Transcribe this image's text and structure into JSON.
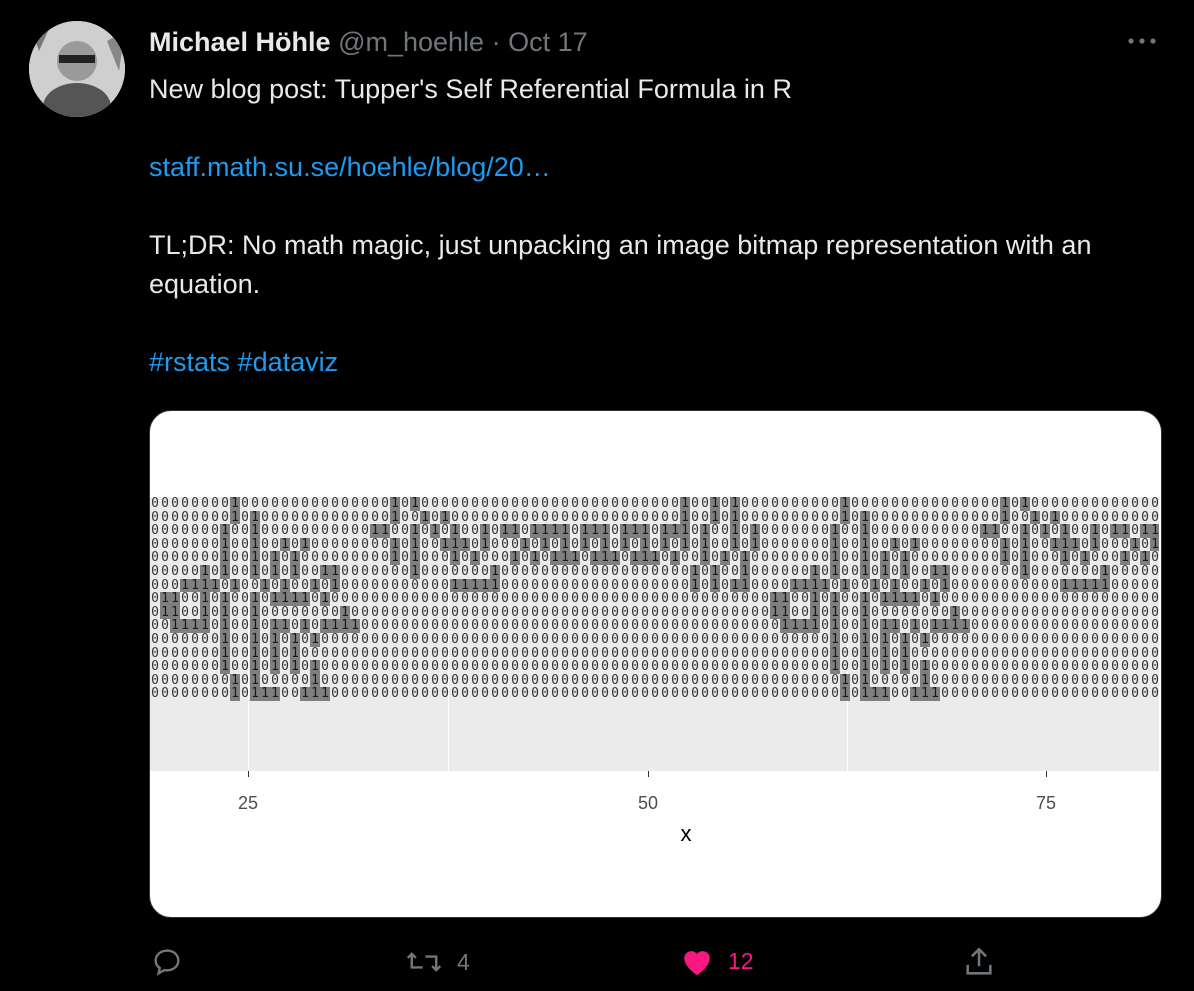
{
  "tweet": {
    "author_name": "Michael Höhle",
    "handle": "@m_hoehle",
    "separator": "·",
    "date": "Oct 17",
    "more_label": "•••",
    "line1": "New blog post: Tupper's Self Referential Formula in R",
    "link": "staff.math.su.se/hoehle/blog/20…",
    "line3": "TL;DR: No math magic, just unpacking an image bitmap representation with an equation.",
    "hashtag1": "#rstats",
    "hashtag2": "#dataviz"
  },
  "actions": {
    "reply_count": "",
    "retweet_count": "4",
    "like_count": "12",
    "like_color": "#f91880"
  },
  "chart_data": {
    "type": "heatmap",
    "xlabel": "x",
    "ylabel": "",
    "x_ticks": [
      "25",
      "50",
      "75"
    ],
    "x_tick_values": [
      25,
      50,
      75
    ],
    "xlim": [
      18,
      82
    ],
    "rows": [
      "0000000010000000000000001010000000000000000000000000010010100",
      "0000000010100000000000001001010000000000000000000000010010100",
      "0000000100100000000000110010101001011011110111011101110100101",
      "0000000100100101000000001010011101000101010101010101010100101",
      "0000000100101010000000001010001010001010111011101110100101010",
      "0000010100101010011000000010000000100000000000000000001010010",
      "0001111010010100101000000000001111100000000000000000001010110",
      "0110010100101111010000000000000000000000000000000000000000000",
      "0110010100100000000100000000000000000000000000000000000000000",
      "0011110100101101011110000000000000000000000000000000000000000",
      "0000000100101010100000000000000000000000000000000000000000000",
      "0000000100101010000000000000000000000000000000000000000000000",
      "0000000100101010100000000000000000000000000000000000000000000",
      "0000000010100000100000000000000000000000000000000000000000000",
      "0000000010111001110000000000000000000000000000000000000000000"
    ]
  }
}
